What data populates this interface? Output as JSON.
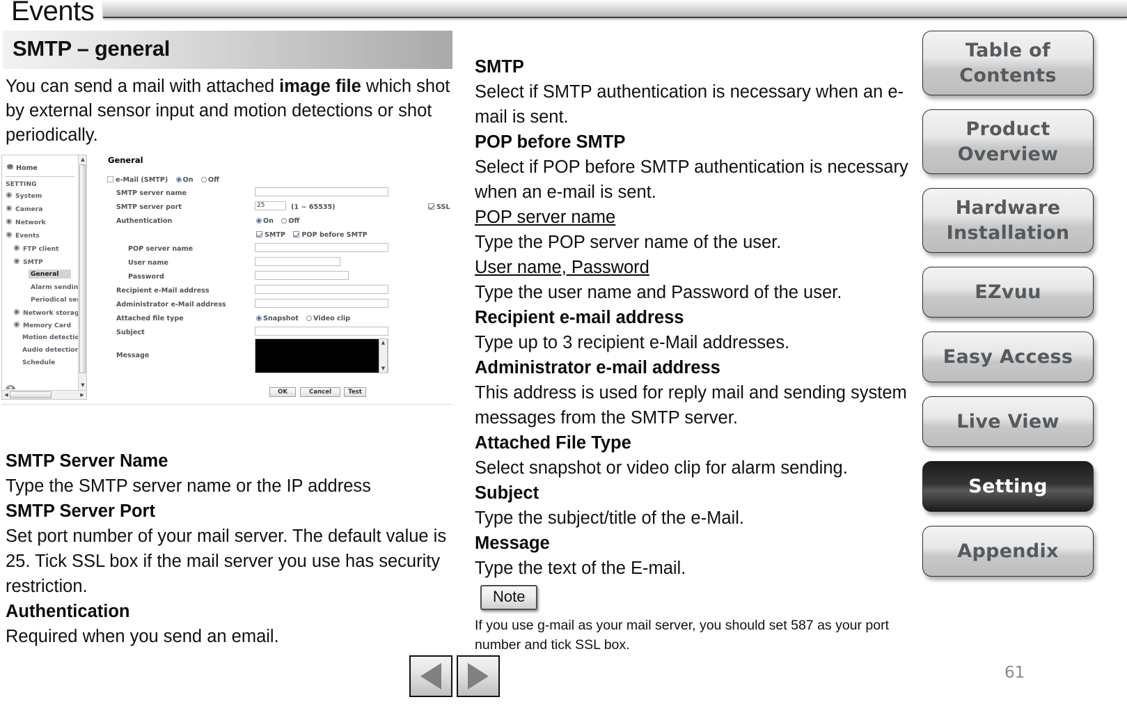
{
  "header": {
    "title": "Events"
  },
  "section": {
    "title": "SMTP – general",
    "intro_part1": "You can send a mail with attached ",
    "intro_bold": "image file",
    "intro_part2": " which shot by external sensor input and motion detections or shot periodically."
  },
  "app_screenshot": {
    "sidebar": {
      "home_label": "Home",
      "group_heading": "SETTING",
      "items": [
        {
          "label": "System"
        },
        {
          "label": "Camera"
        },
        {
          "label": "Network"
        },
        {
          "label": "Events"
        },
        {
          "label": "FTP client"
        },
        {
          "label": "SMTP"
        },
        {
          "label": "General"
        },
        {
          "label": "Alarm sending"
        },
        {
          "label": "Periodical send"
        },
        {
          "label": "Network storage"
        },
        {
          "label": "Memory Card"
        },
        {
          "label": "Motion detection"
        },
        {
          "label": "Audio detection"
        },
        {
          "label": "Schedule"
        }
      ],
      "help_glyph": "?"
    },
    "form": {
      "title": "General",
      "email_smtp_label": "e-Mail (SMTP)",
      "on_label": "On",
      "off_label": "Off",
      "labels": {
        "smtp_server_name": "SMTP server name",
        "smtp_server_port": "SMTP server port",
        "authentication": "Authentication",
        "pop_server_name": "POP server name",
        "user_name": "User name",
        "password": "Password",
        "recipient_email": "Recipient e-Mail address",
        "administrator_email": "Administrator e-Mail address",
        "attached_file_type": "Attached file type",
        "subject": "Subject",
        "message": "Message"
      },
      "port_value": "25",
      "port_range": "(1 ~ 65535)",
      "ssl_label": "SSL",
      "auth_smtp_label": "SMTP",
      "auth_pop_label": "POP before SMTP",
      "snapshot_label": "Snapshot",
      "videoclip_label": "Video clip",
      "buttons": {
        "ok": "OK",
        "cancel": "Cancel",
        "test": "Test"
      }
    }
  },
  "left_definitions": [
    {
      "term": "SMTP Server Name",
      "desc": "Type the SMTP server name or the IP address"
    },
    {
      "term": "SMTP Server Port",
      "desc": "Set port number of your mail server. The default value is 25. Tick SSL box if the mail server you use has security restriction."
    },
    {
      "term": "Authentication",
      "desc": "Required when you send an email."
    }
  ],
  "mid_definitions": [
    {
      "term": "SMTP",
      "style": "bold",
      "desc": "Select if SMTP authentication is necessary when an e-mail is sent."
    },
    {
      "term": "POP before SMTP",
      "style": "bold",
      "desc": "Select if POP before SMTP authentication is necessary when an e-mail is sent."
    },
    {
      "term": "POP server name",
      "style": "underline",
      "desc": "Type the POP server name of the user."
    },
    {
      "term": "User name, Password",
      "style": "underline",
      "desc": "Type the user name and Password of the user."
    },
    {
      "term": "Recipient e-mail address",
      "style": "bold",
      "desc": "Type up to 3 recipient e-Mail addresses."
    },
    {
      "term": "Administrator e-mail address",
      "style": "bold",
      "desc": "This address is used for reply mail and sending system messages from the SMTP server."
    },
    {
      "term": "Attached File Type",
      "style": "bold",
      "desc": "Select snapshot or video clip for alarm sending."
    },
    {
      "term": "Subject",
      "style": "bold",
      "desc": "Type the subject/title of the e-Mail."
    },
    {
      "term": "Message",
      "style": "bold",
      "desc": "Type the text of the E-mail."
    }
  ],
  "note": {
    "badge": "Note",
    "text": "If you use g-mail as your mail server, you should set 587 as your port number and tick SSL box."
  },
  "right_nav": [
    {
      "label": "Table of Contents",
      "lines": [
        "Table of",
        "Contents"
      ],
      "active": false
    },
    {
      "label": "Product Overview",
      "lines": [
        "Product",
        "Overview"
      ],
      "active": false
    },
    {
      "label": "Hardware Installation",
      "lines": [
        "Hardware",
        "Installation"
      ],
      "active": false
    },
    {
      "label": "EZvuu",
      "lines": [
        "EZvuu"
      ],
      "active": false
    },
    {
      "label": "Easy Access",
      "lines": [
        "Easy Access"
      ],
      "active": false
    },
    {
      "label": "Live View",
      "lines": [
        "Live View"
      ],
      "active": false
    },
    {
      "label": "Setting",
      "lines": [
        "Setting"
      ],
      "active": true
    },
    {
      "label": "Appendix",
      "lines": [
        "Appendix"
      ],
      "active": false
    }
  ],
  "pager": {
    "prev_icon": "triangle-left-icon",
    "next_icon": "triangle-right-icon"
  },
  "page_number": "61",
  "colors": {
    "accent_dark": "#1b1b1b",
    "nav_text": "#555a5e",
    "page_number": "#8a8a8a"
  }
}
